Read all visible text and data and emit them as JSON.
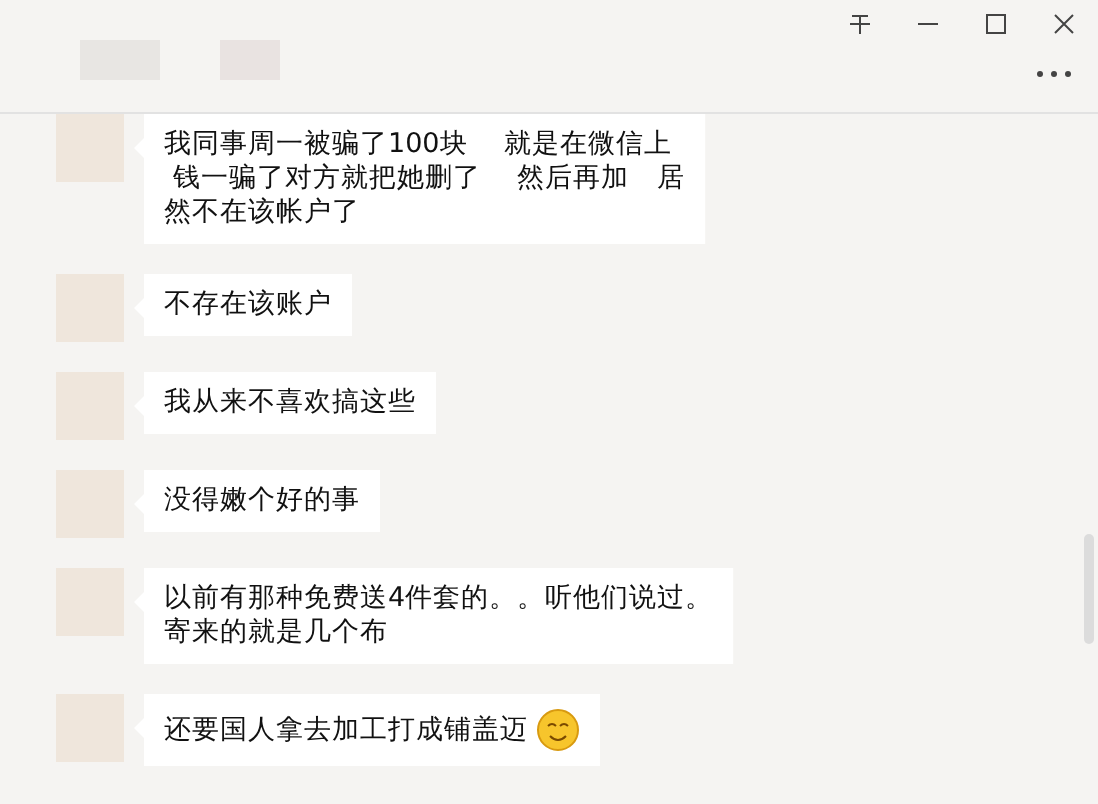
{
  "messages": [
    {
      "lines": [
        "我同事周一被骗了100块　 就是在微信上",
        " 钱一骗了对方就把她删了　 然后再加　居",
        "然不在该帐户了"
      ],
      "has_emoji": false
    },
    {
      "lines": [
        "不存在该账户"
      ],
      "has_emoji": false
    },
    {
      "lines": [
        "我从来不喜欢搞这些"
      ],
      "has_emoji": false
    },
    {
      "lines": [
        "没得嫩个好的事"
      ],
      "has_emoji": false
    },
    {
      "lines": [
        "以前有那种免费送4件套的。。听他们说过。",
        "寄来的就是几个布"
      ],
      "has_emoji": false
    },
    {
      "lines": [
        "还要国人拿去加工打成铺盖迈"
      ],
      "has_emoji": true
    }
  ]
}
